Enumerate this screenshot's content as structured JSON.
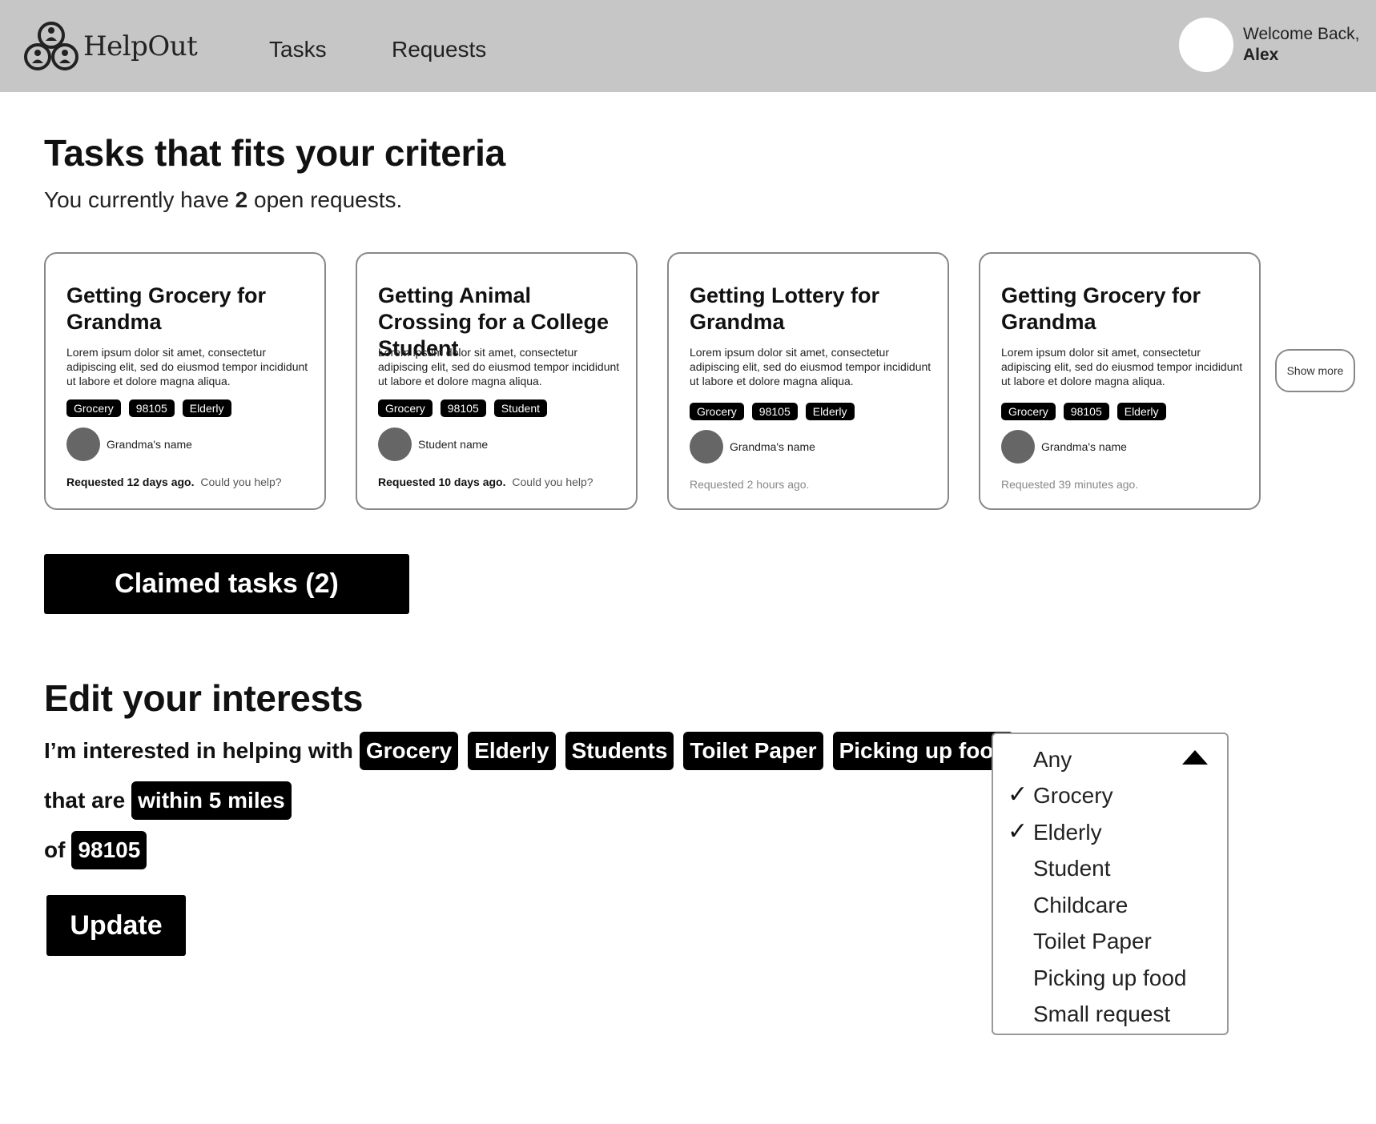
{
  "header": {
    "logo_text": "HelpOut",
    "nav": [
      "Tasks",
      "Requests"
    ],
    "welcome": "Welcome Back,",
    "user_name": "Alex"
  },
  "tasks_section": {
    "title": "Tasks that fits your criteria",
    "open_prefix": "You currently have",
    "open_count": "2",
    "open_suffix": "open requests."
  },
  "cards": [
    {
      "title": "Getting Grocery for Grandma",
      "desc": "Lorem ipsum dolor sit amet, consectetur adipiscing elit, sed do eiusmod tempor incididunt ut labore et dolore magna aliqua.",
      "tags": [
        "Grocery",
        "98105",
        "Elderly"
      ],
      "person": "Grandma's name",
      "requested": "Requested 12 days ago.",
      "help": "Could you help?"
    },
    {
      "title": "Getting Animal Crossing for a College Student",
      "desc": "Lorem ipsum dolor sit amet, consectetur adipiscing elit, sed do eiusmod tempor incididunt ut labore et dolore magna aliqua.",
      "tags": [
        "Grocery",
        "98105",
        "Student"
      ],
      "person": "Student name",
      "requested": "Requested 10 days ago.",
      "help": "Could you help?"
    },
    {
      "title": "Getting Lottery for Grandma",
      "desc": "Lorem ipsum dolor sit amet, consectetur adipiscing elit, sed do eiusmod tempor incididunt ut labore et dolore magna aliqua.",
      "tags": [
        "Grocery",
        "98105",
        "Elderly"
      ],
      "person": "Grandma's name",
      "requested": "Requested 2 hours ago."
    },
    {
      "title": "Getting Grocery for Grandma",
      "desc": "Lorem ipsum dolor sit amet, consectetur adipiscing elit, sed do eiusmod tempor incididunt ut labore et dolore magna aliqua.",
      "tags": [
        "Grocery",
        "98105",
        "Elderly"
      ],
      "person": "Grandma's name",
      "requested": "Requested 39 minutes ago."
    }
  ],
  "show_more": "Show more",
  "claimed_button": "Claimed tasks (2)",
  "interests": {
    "title": "Edit your interests",
    "line1_prefix": "I’m interested in helping with",
    "chips": [
      "Grocery",
      "Elderly",
      "Students",
      "Toilet Paper",
      "Picking up food"
    ],
    "line2_prefix": "that are",
    "distance": "within 5 miles",
    "line3_prefix": "of",
    "zip": "98105",
    "update_button": "Update"
  },
  "dropdown": {
    "options": [
      "Any",
      "Grocery",
      "Elderly",
      "Student",
      "Childcare",
      "Toilet Paper",
      "Picking up food",
      "Small request"
    ],
    "checked": [
      "Grocery",
      "Elderly"
    ],
    "check_glyph": "✓"
  }
}
